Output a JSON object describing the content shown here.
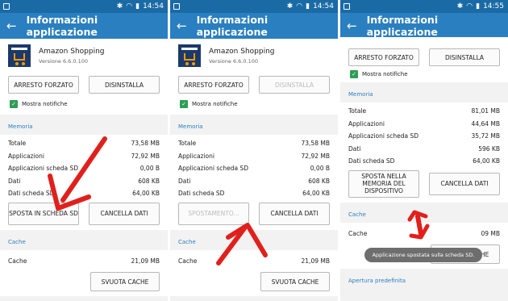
{
  "status": {
    "time1": "14:54",
    "time2": "14:54",
    "time3": "14:55"
  },
  "appbar": {
    "title": "Informazioni applicazione"
  },
  "app": {
    "name": "Amazon Shopping",
    "version": "Versione 6.6.0.100"
  },
  "buttons": {
    "force_stop": "ARRESTO FORZATO",
    "uninstall": "DISINSTALLA",
    "move_to_sd": "SPOSTA IN SCHEDA SD",
    "moving": "SPOSTAMENTO...",
    "move_to_memory": "SPOSTA NELLA MEMORIA DEL DISPOSITIVO",
    "clear_data": "CANCELLA DATI",
    "clear_cache": "SVUOTA CACHE"
  },
  "notifications": {
    "label": "Mostra notifiche"
  },
  "sections": {
    "memory": "Memoria",
    "cache": "Cache",
    "default": "Apertura predefinita"
  },
  "labels": {
    "total": "Totale",
    "apps": "Applicazioni",
    "apps_sd": "Applicazioni scheda SD",
    "data": "Dati",
    "data_sd": "Dati scheda SD",
    "cache": "Cache"
  },
  "panel1": {
    "total": "73,58 MB",
    "apps": "72,92 MB",
    "apps_sd": "0,00 B",
    "data": "608 KB",
    "data_sd": "64,00 KB",
    "cache": "21,09 MB"
  },
  "panel2": {
    "total": "73,58 MB",
    "apps": "72,92 MB",
    "apps_sd": "0,00 B",
    "data": "608 KB",
    "data_sd": "64,00 KB",
    "cache": "21,09 MB"
  },
  "panel3": {
    "total": "81,01 MB",
    "apps": "44,64 MB",
    "apps_sd": "35,72 MB",
    "data": "596 KB",
    "data_sd": "64,00 KB",
    "cache": "09 MB"
  },
  "toast": {
    "text": "Applicazione spostata sulla scheda SD."
  },
  "colors": {
    "accent": "#2a7fc0",
    "statusbar": "#1a6aa5",
    "arrow": "#e0201c",
    "check": "#2e9d55"
  }
}
